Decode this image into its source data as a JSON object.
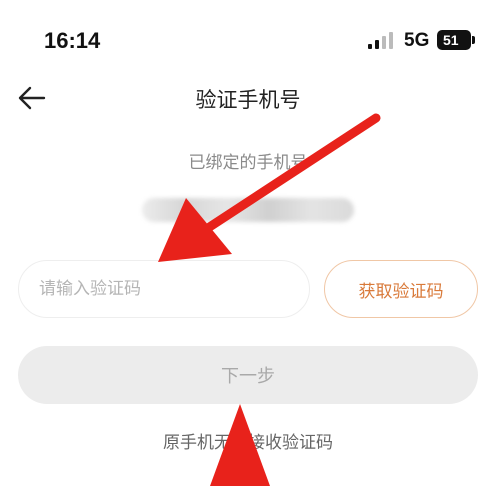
{
  "status_bar": {
    "time": "16:14",
    "network": "5G",
    "battery": "51"
  },
  "header": {
    "back_icon": "back-arrow-icon",
    "title": "验证手机号"
  },
  "bound_phone": {
    "label": "已绑定的手机号"
  },
  "verification": {
    "code_placeholder": "请输入验证码",
    "get_code_label": "获取验证码"
  },
  "next_label": "下一步",
  "cannot_receive_label": "原手机无法接收验证码",
  "annotations": {
    "arrow_color": "#e8221b",
    "icon": "red-arrow-icon"
  },
  "colors": {
    "accent": "#d97a3a",
    "accent_border": "#f0c7a6",
    "disabled_bg": "#ececec",
    "disabled_text": "#a9a9a9"
  }
}
